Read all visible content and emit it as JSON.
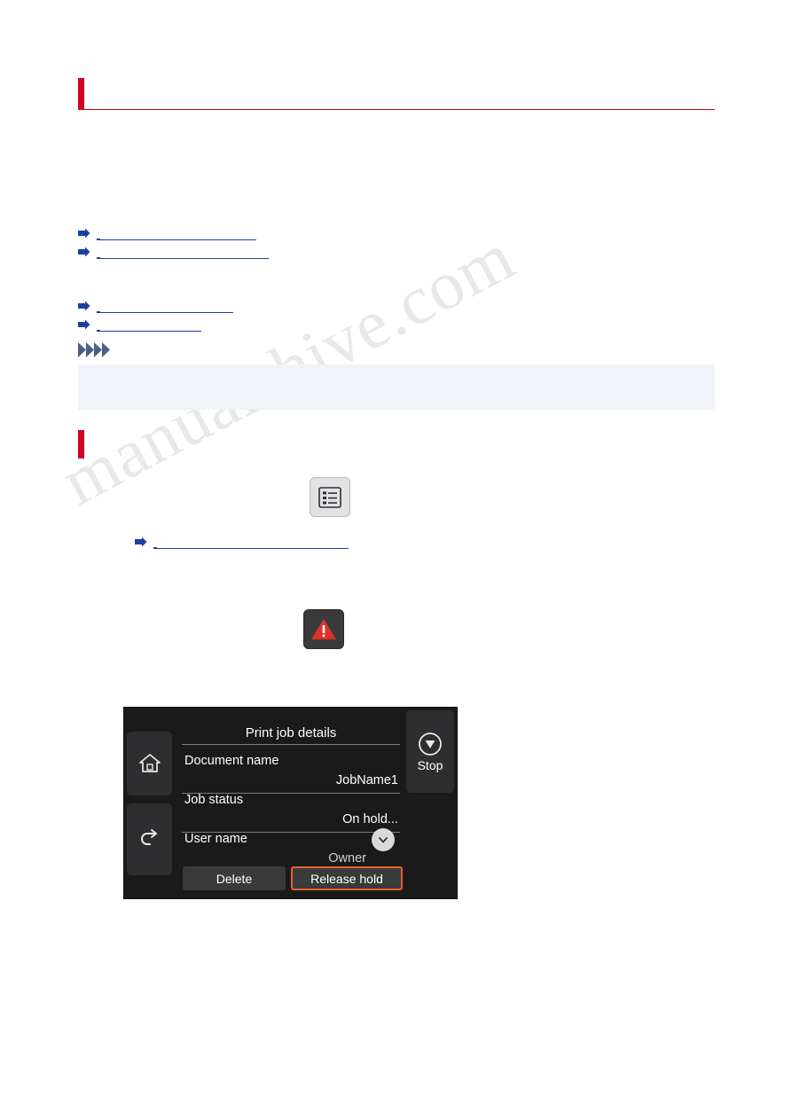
{
  "page": {
    "watermark_lines": [
      "manualshive.com"
    ]
  },
  "heading": {
    "title": "",
    "section_title": ""
  },
  "links": [
    {
      "text": "",
      "icon": "arrow-right-icon"
    },
    {
      "text": "",
      "icon": "arrow-right-icon"
    },
    {
      "text": "",
      "icon": "arrow-right-icon"
    },
    {
      "text": "",
      "icon": "arrow-right-icon"
    },
    {
      "text": "",
      "icon": "arrow-right-icon"
    }
  ],
  "note": {
    "label": "",
    "body": "",
    "icon": "note-chevrons-icon"
  },
  "steps": [
    {
      "text": ""
    },
    {
      "text": ""
    },
    {
      "text": ""
    }
  ],
  "icons": {
    "menu_tile": "list-menu-icon",
    "alert_tile": "warning-exclamation-icon"
  },
  "lcd": {
    "title": "Print job details",
    "rows": [
      {
        "label": "Document name",
        "value": "JobName1"
      },
      {
        "label": "Job status",
        "value": "On hold..."
      },
      {
        "label": "User name",
        "value": "Owner"
      }
    ],
    "buttons": {
      "delete": "Delete",
      "release": "Release hold",
      "stop": "Stop"
    },
    "keys": {
      "home": "home-icon",
      "back": "back-arrow-icon",
      "scroll": "chevron-down-icon",
      "stop_icon": "stop-octagon-icon"
    },
    "accent_color": "#e8602c"
  },
  "colors": {
    "heading_bar": "#d00020",
    "heading_line": "#c00018",
    "link": "#1d3fa0",
    "note_bg": "#f0f3f8"
  }
}
